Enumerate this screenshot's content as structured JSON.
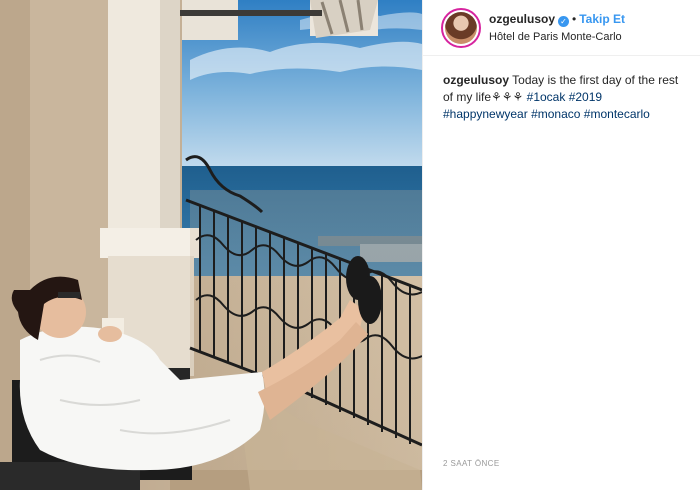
{
  "post": {
    "username": "ozgeulusoy",
    "verified_mark": "✓",
    "separator": "•",
    "follow_label": "Takip Et",
    "location": "Hôtel de Paris Monte-Carlo",
    "caption": {
      "username": "ozgeulusoy",
      "text": "Today is the first day of the rest of my life",
      "emojis": "⚘⚘⚘",
      "hashtags": [
        "#1ocak",
        "#2019",
        "#happynewyear",
        "#monaco",
        "#montecarlo"
      ]
    },
    "timestamp": "2 SAAT ÖNCE"
  },
  "icons": {
    "verified": "verified-badge-icon",
    "emojis": "flower-emoji-icon"
  },
  "colors": {
    "accent_blue": "#3897f0",
    "hashtag": "#003569",
    "text": "#262626",
    "muted": "#999999"
  }
}
